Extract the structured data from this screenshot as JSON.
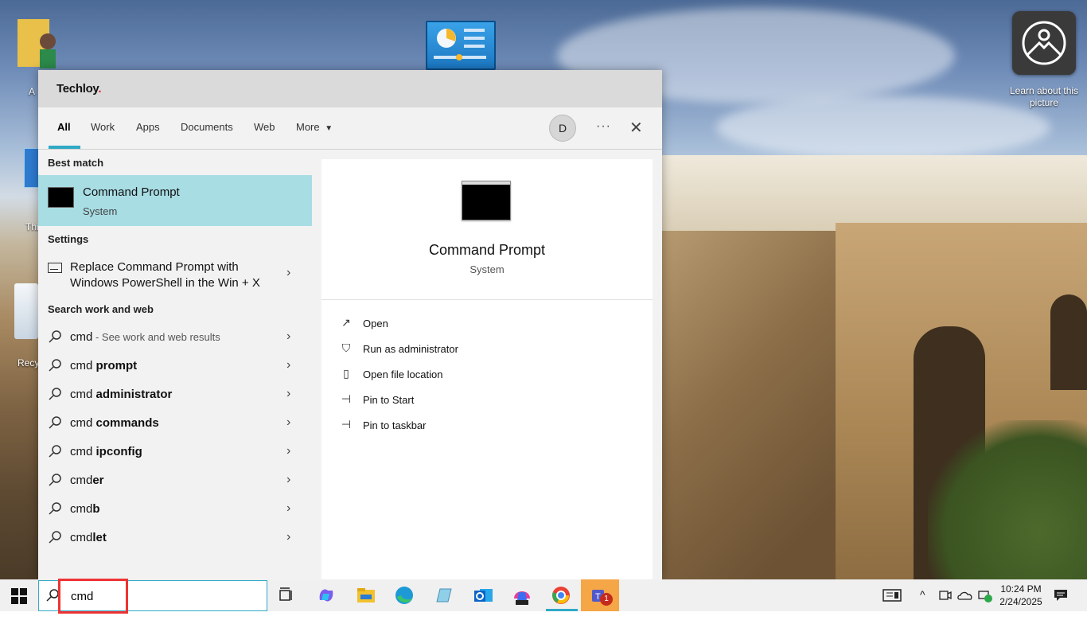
{
  "desktop": {
    "learn_label": "Learn about this picture",
    "partial_labels": {
      "a": "A",
      "thi": "Thi",
      "recy": "Recy"
    }
  },
  "panel": {
    "brand": "Techloy",
    "brand_dot": ".",
    "tabs": [
      "All",
      "Work",
      "Apps",
      "Documents",
      "Web",
      "More"
    ],
    "active_tab": "All",
    "avatar_letter": "D",
    "more_options": "···",
    "close": "✕"
  },
  "results": {
    "best_match_title": "Best match",
    "best_match": {
      "name": "Command Prompt",
      "type": "System"
    },
    "settings_title": "Settings",
    "setting": {
      "label": "Replace Command Prompt with Windows PowerShell in the Win + X"
    },
    "web_title": "Search work and web",
    "web_items": [
      {
        "prefix": "cmd",
        "bold": "",
        "suffix": " - See work and web results"
      },
      {
        "prefix": "cmd ",
        "bold": "prompt",
        "suffix": ""
      },
      {
        "prefix": "cmd ",
        "bold": "administrator",
        "suffix": ""
      },
      {
        "prefix": "cmd ",
        "bold": "commands",
        "suffix": ""
      },
      {
        "prefix": "cmd ",
        "bold": "ipconfig",
        "suffix": ""
      },
      {
        "prefix": "cmd",
        "bold": "er",
        "suffix": ""
      },
      {
        "prefix": "cmd",
        "bold": "b",
        "suffix": ""
      },
      {
        "prefix": "cmd",
        "bold": "let",
        "suffix": ""
      }
    ]
  },
  "preview": {
    "name": "Command Prompt",
    "type": "System",
    "actions": [
      {
        "icon": "open-icon",
        "label": "Open"
      },
      {
        "icon": "shield-icon",
        "label": "Run as administrator"
      },
      {
        "icon": "file-location-icon",
        "label": "Open file location"
      },
      {
        "icon": "pin-icon",
        "label": "Pin to Start"
      },
      {
        "icon": "pin-icon",
        "label": "Pin to taskbar"
      }
    ]
  },
  "taskbar": {
    "search_value": "cmd",
    "time": "10:24 PM",
    "date": "2/24/2025",
    "teams_badge": "1",
    "apps": [
      "task-view",
      "copilot",
      "file-explorer",
      "edge",
      "notepad",
      "outlook",
      "microsoft-365",
      "chrome",
      "teams"
    ]
  },
  "colors": {
    "accent": "#2fa9c6",
    "best_match_bg": "#a8dde4",
    "highlight_red": "#e33"
  }
}
